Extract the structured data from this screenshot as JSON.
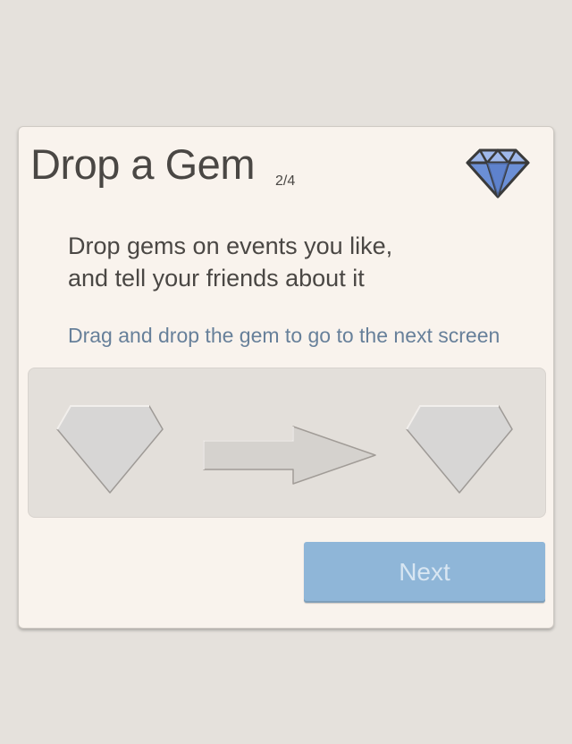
{
  "card": {
    "title": "Drop a Gem",
    "step_indicator": "2/4",
    "description_line1": "Drop gems on events you like,",
    "description_line2": "and tell your friends about it",
    "hint": "Drag and drop the gem to go to the next screen",
    "next_button_label": "Next",
    "next_button_state": "disabled"
  },
  "icons": {
    "header": "diamond-gem-icon",
    "source_slot": "gem-slot-icon",
    "arrow": "arrow-right-icon",
    "target_slot": "gem-slot-icon"
  },
  "colors": {
    "page_background": "#e5e1dc",
    "card_background": "#f9f3ed",
    "text": "#4a4744",
    "hint_text": "#67809a",
    "dropzone_background": "#e3dfda",
    "gem_blue": "#6b8fd6",
    "button_background": "#8fb6d8",
    "button_text": "#d8e6f2"
  }
}
